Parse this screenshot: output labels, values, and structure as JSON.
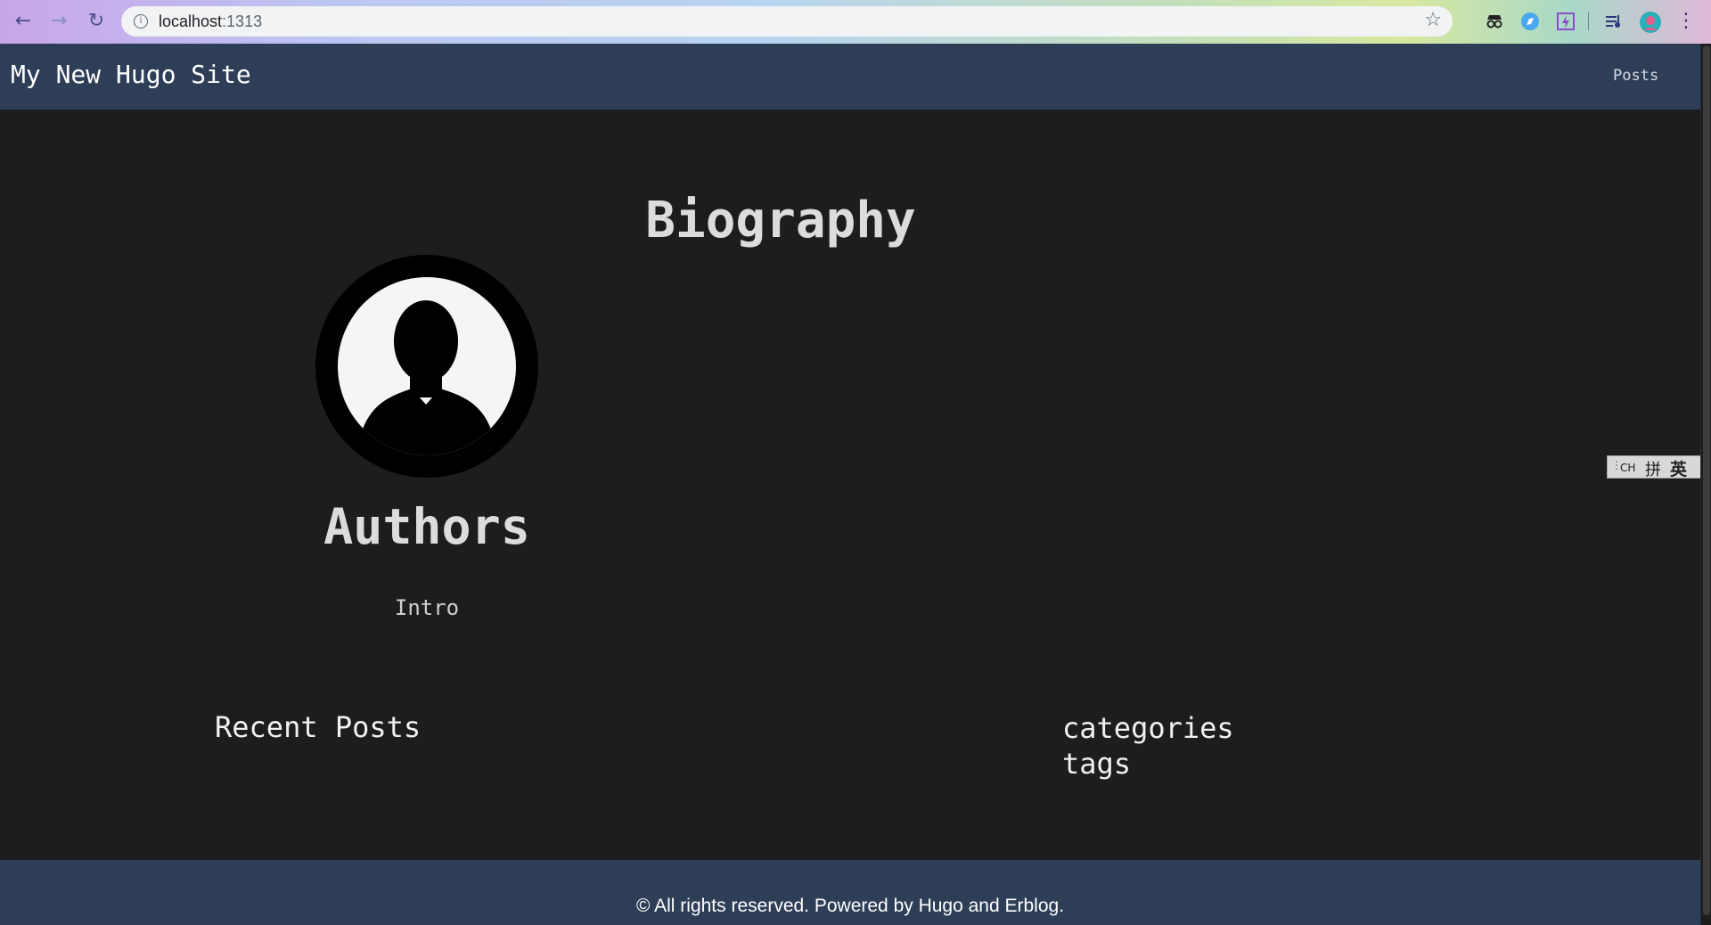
{
  "browser": {
    "url_host": "localhost",
    "url_port": ":1313",
    "back_icon": "arrow-left",
    "forward_icon": "arrow-right",
    "reload_icon": "reload",
    "info_icon": "i",
    "star_icon": "☆",
    "menu_icon": "⋮",
    "extensions": [
      {
        "name": "incognito-icon",
        "glyph": "👓"
      },
      {
        "name": "compass-icon",
        "glyph": "◉"
      },
      {
        "name": "bolt-icon",
        "glyph": "ϟ"
      },
      {
        "name": "playlist-icon",
        "glyph": "≡"
      },
      {
        "name": "profile-avatar",
        "glyph": "●"
      }
    ]
  },
  "header": {
    "site_title": "My New Hugo Site",
    "nav": [
      {
        "label": "Posts"
      }
    ]
  },
  "main": {
    "heading": "Biography",
    "author": {
      "name": "Authors",
      "intro": "Intro"
    },
    "recent_posts_title": "Recent Posts",
    "taxonomies": [
      "categories",
      "tags"
    ]
  },
  "ime": {
    "ch": "CH",
    "pinyin": "拼",
    "english": "英"
  },
  "footer": {
    "text": "© All rights reserved. Powered by Hugo and Erblog."
  },
  "colors": {
    "header_bg": "#2e3e57",
    "page_bg": "#1c1d1f",
    "text": "#dcdcdc"
  }
}
